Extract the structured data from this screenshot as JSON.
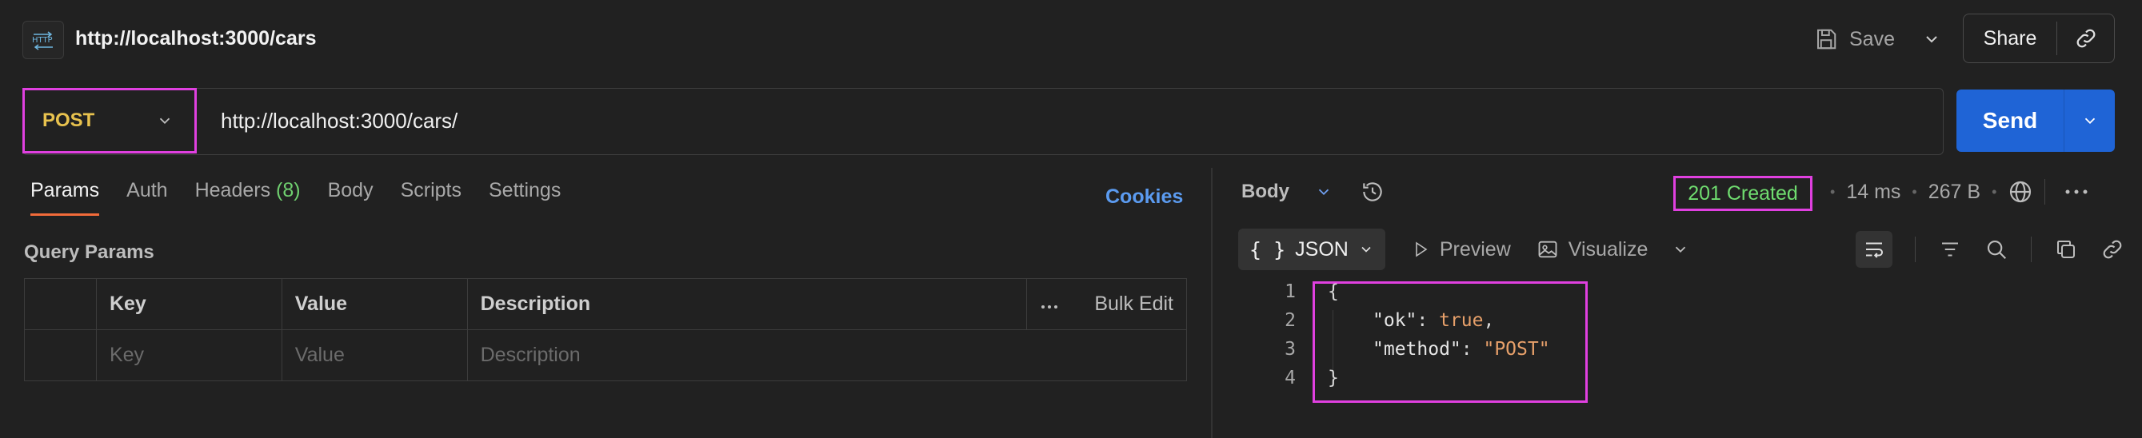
{
  "header": {
    "title": "http://localhost:3000/cars",
    "save_label": "Save",
    "share_label": "Share"
  },
  "request": {
    "method": "POST",
    "url": "http://localhost:3000/cars/",
    "send_label": "Send"
  },
  "tabs": [
    {
      "label": "Params",
      "active": true
    },
    {
      "label": "Auth"
    },
    {
      "label": "Headers",
      "count": "(8)"
    },
    {
      "label": "Body"
    },
    {
      "label": "Scripts"
    },
    {
      "label": "Settings"
    }
  ],
  "cookies_label": "Cookies",
  "query_params": {
    "title": "Query Params",
    "columns": [
      "Key",
      "Value",
      "Description"
    ],
    "bulk_edit": "Bulk Edit",
    "placeholders": [
      "Key",
      "Value",
      "Description"
    ]
  },
  "response": {
    "body_label": "Body",
    "status": "201 Created",
    "time": "14 ms",
    "size": "267 B",
    "format": "JSON",
    "preview_label": "Preview",
    "visualize_label": "Visualize",
    "line_numbers": [
      "1",
      "2",
      "3",
      "4"
    ],
    "code": {
      "open": "{",
      "key1": "\"ok\"",
      "val1": "true",
      "key2": "\"method\"",
      "val2": "\"POST\"",
      "close": "}"
    }
  },
  "colors": {
    "method": "#e8c24e",
    "send": "#1f64d6",
    "status_ok": "#6fdc6f",
    "highlight": "#e040e0",
    "cookies": "#5b9bf0"
  }
}
